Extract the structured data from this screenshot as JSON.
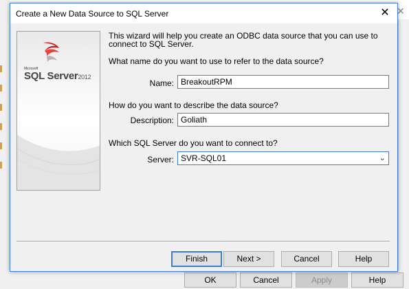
{
  "dialog": {
    "title": "Create a New Data Source to SQL Server",
    "close_glyph": "✕"
  },
  "sidebar": {
    "logo_small": "Microsoft",
    "logo_text": "SQL Server",
    "logo_year": "2012"
  },
  "wizard": {
    "intro": "This wizard will help you create an ODBC data source that you can use to connect to SQL Server.",
    "name_question": "What name do you want to use to refer to the data source?",
    "name_label": "Name:",
    "name_value": "BreakoutRPM",
    "description_question": "How do you want to describe the data source?",
    "description_label": "Description:",
    "description_value": "Goliath",
    "server_question": "Which SQL Server do you want to connect to?",
    "server_label": "Server:",
    "server_value": "SVR-SQL01"
  },
  "buttons": {
    "finish": "Finish",
    "next": "Next >",
    "cancel": "Cancel",
    "help": "Help"
  },
  "background_dialog": {
    "ok": "OK",
    "cancel": "Cancel",
    "apply": "Apply",
    "help": "Help",
    "close_glyph": "✕"
  },
  "colors": {
    "accent": "#3c7bd6",
    "dialog_bg": "#f0f0f0"
  }
}
